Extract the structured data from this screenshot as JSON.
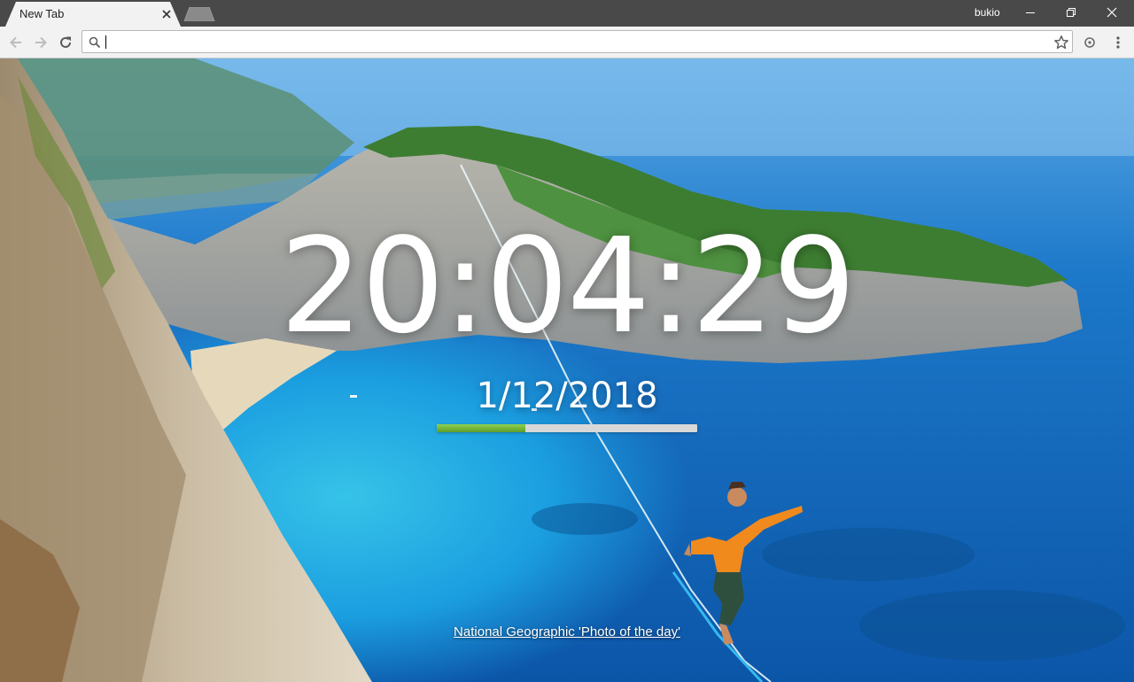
{
  "tab": {
    "title": "New Tab"
  },
  "window": {
    "profile_name": "bukio"
  },
  "omnibox": {
    "value": "",
    "placeholder": ""
  },
  "clock": {
    "time": "20:04:29",
    "date": "1/12/2018",
    "day_progress": 0.34
  },
  "background": {
    "credit_text": "National Geographic 'Photo of the day'"
  },
  "icons": {
    "back": "arrow-left-icon",
    "forward": "arrow-right-icon",
    "reload": "reload-icon",
    "search": "search-icon",
    "bookmark": "star-icon",
    "extension": "extension-icon",
    "menu": "kebab-menu-icon"
  },
  "colors": {
    "titlebar": "#494949",
    "progress_fill": "#6eb33a",
    "progress_track": "#d8d8d8"
  }
}
